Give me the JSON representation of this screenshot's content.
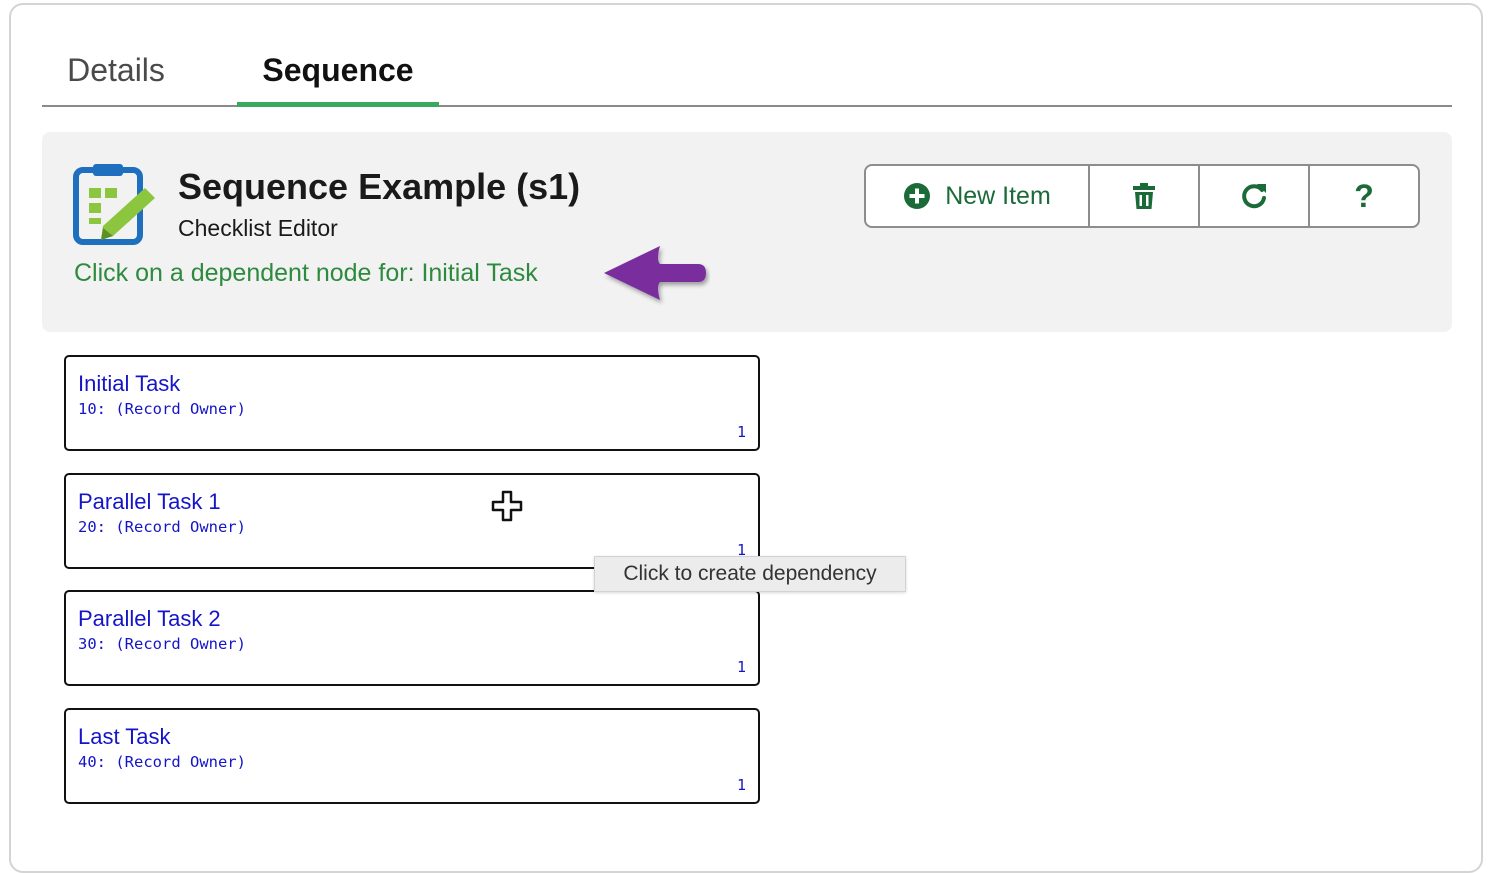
{
  "tabs": {
    "details": "Details",
    "sequence": "Sequence",
    "active": "Sequence"
  },
  "header": {
    "title": "Sequence Example (s1)",
    "subtitle": "Checklist Editor",
    "instruction": "Click on a dependent node for: Initial Task"
  },
  "toolbar": {
    "new_item_label": "New Item",
    "help_label": "?",
    "icons": [
      "plus-circle-icon",
      "trash-icon",
      "refresh-icon",
      "help-icon"
    ]
  },
  "nodes": [
    {
      "name": "Initial Task",
      "owner": "10: (Record Owner)",
      "count": "1"
    },
    {
      "name": "Parallel Task 1",
      "owner": "20: (Record Owner)",
      "count": "1"
    },
    {
      "name": "Parallel Task 2",
      "owner": "30: (Record Owner)",
      "count": "1"
    },
    {
      "name": "Last Task",
      "owner": "40: (Record Owner)",
      "count": "1"
    }
  ],
  "tooltip": "Click to create dependency",
  "colors": {
    "accent_green": "#3aa85f",
    "toolbar_green": "#1b6b39",
    "instruction_green": "#2e8a3e",
    "node_link_blue": "#1515c8",
    "arrow_purple": "#7a2f9e",
    "icon_blue": "#1f6fbf",
    "icon_lime": "#8cc63f"
  }
}
